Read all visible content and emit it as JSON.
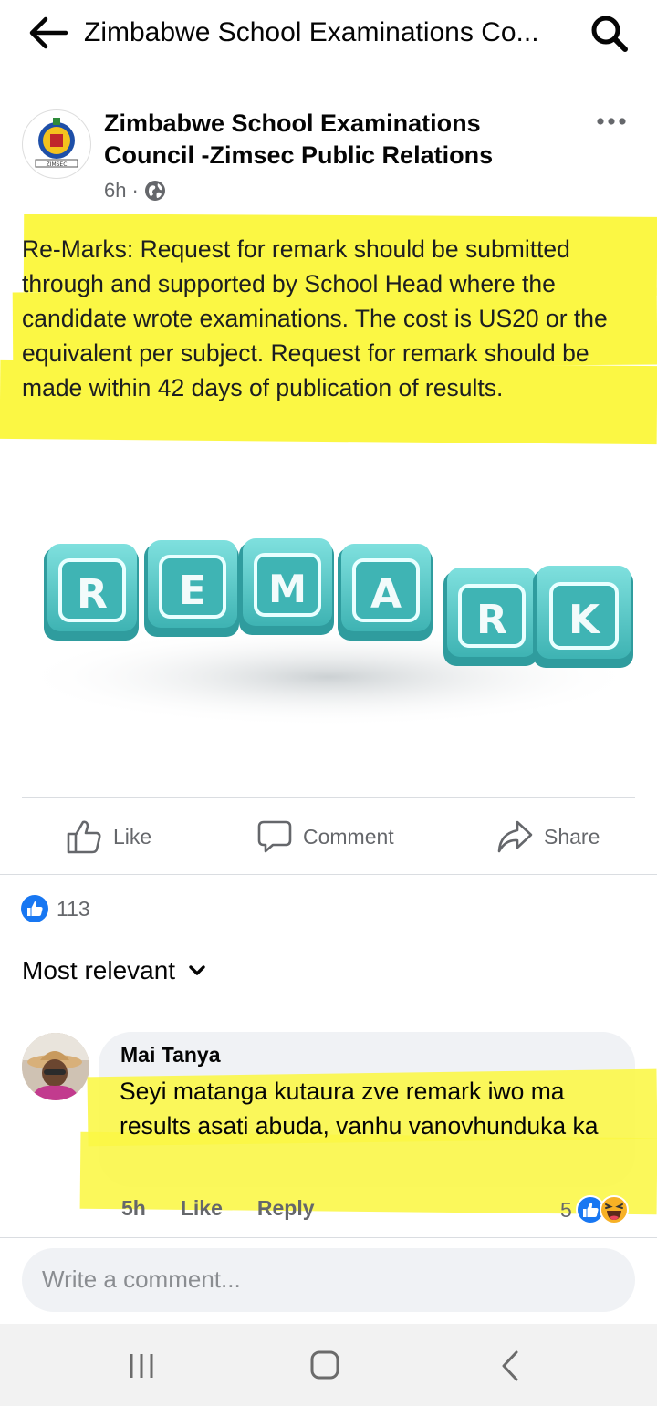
{
  "topbar": {
    "title": "Zimbabwe School Examinations Co..."
  },
  "post": {
    "author": "Zimbabwe School Examinations Council -Zimsec Public Relations",
    "avatar_text": "ZIMSEC",
    "time": "6h",
    "separator": "·",
    "privacy_icon": "globe-icon",
    "text": "Re-Marks: Request for remark should be submitted through and supported by School Head where the candidate wrote examinations. The cost is US20 or the equivalent per subject. Request for remark should be made within 42 days of publication of results.",
    "image_letters": [
      "R",
      "E",
      "M",
      "A",
      "R",
      "K"
    ]
  },
  "actions": {
    "like": "Like",
    "comment": "Comment",
    "share": "Share"
  },
  "reactions": {
    "count": "113"
  },
  "comments_sort": {
    "label": "Most relevant"
  },
  "comment": {
    "author": "Mai Tanya",
    "text": "Seyi matanga kutaura zve remark iwo ma results asati abuda, vanhu vanovhunduka ka",
    "time": "5h",
    "like": "Like",
    "reply": "Reply",
    "reaction_count": "5"
  },
  "composer": {
    "placeholder": "Write a comment..."
  },
  "colors": {
    "highlight": "#fbf744",
    "facebook_blue": "#1877f2",
    "tile": "#4fc1c0"
  }
}
